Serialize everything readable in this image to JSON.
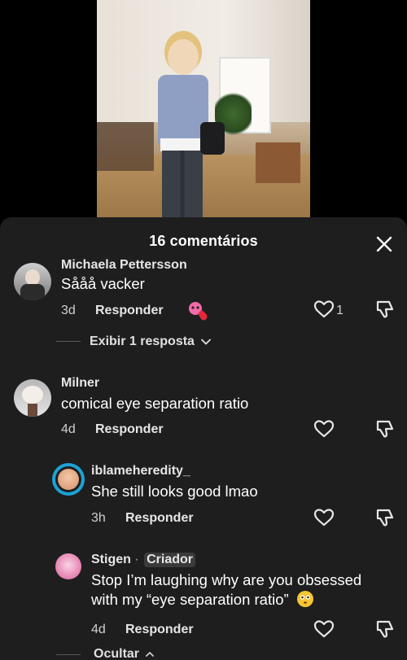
{
  "header": {
    "title": "16 comentários"
  },
  "comments": [
    {
      "username": "Michaela Pettersson",
      "text": "Sååå vacker",
      "time": "3d",
      "reply_label": "Responder",
      "likes": "1"
    },
    {
      "username": "Milner",
      "text": "comical eye separation ratio",
      "time": "4d",
      "reply_label": "Responder"
    },
    {
      "username": "iblameheredity_",
      "text": "She still looks good lmao",
      "time": "3h",
      "reply_label": "Responder"
    },
    {
      "username": "Stigen",
      "creator_badge": "Criador",
      "text_line1": "Stop I’m laughing why are you obsessed",
      "text_line2": "with my “eye separation ratio”",
      "time": "4d",
      "reply_label": "Responder"
    }
  ],
  "threads": {
    "view_replies": "Exibir 1 resposta",
    "hide": "Ocultar"
  },
  "icons": [
    "close-icon",
    "heart-icon",
    "dislike-icon",
    "chevron-down-icon",
    "chevron-up-icon",
    "emoji-sticker-icon",
    "flushed-emoji-icon"
  ],
  "colors": {
    "sheet_bg": "#1e1e1e",
    "text": "#ffffff",
    "muted": "#d0d0d0"
  }
}
